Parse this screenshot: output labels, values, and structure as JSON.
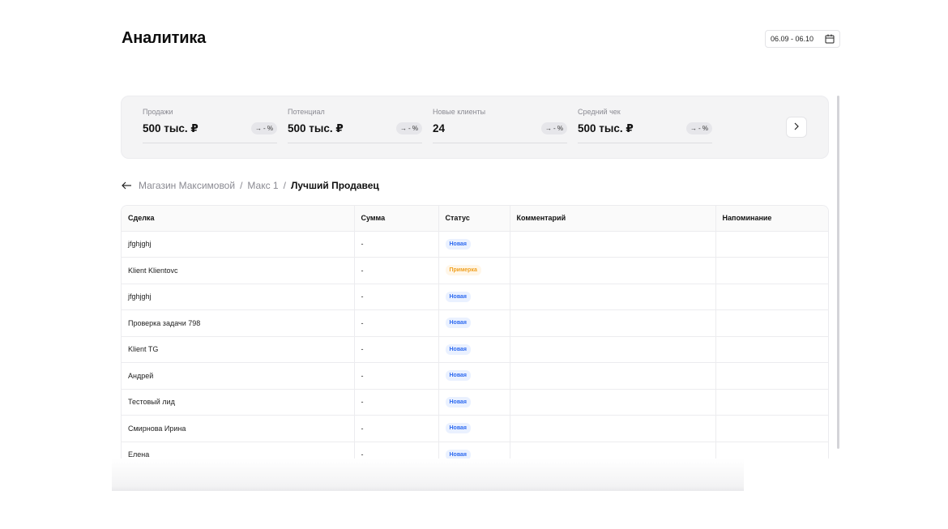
{
  "header": {
    "title": "Аналитика",
    "date_range": "06.09 - 06.10"
  },
  "kpis": [
    {
      "label": "Продажи",
      "value": "500 тыс. ₽",
      "trend": "- %"
    },
    {
      "label": "Потенциал",
      "value": "500 тыс. ₽",
      "trend": "- %"
    },
    {
      "label": "Новые клиенты",
      "value": "24",
      "trend": "- %"
    },
    {
      "label": "Средний чек",
      "value": "500 тыс. ₽",
      "trend": "- %"
    }
  ],
  "breadcrumb": {
    "items": [
      "Магазин Максимовой",
      "Макс 1"
    ],
    "separator": "/",
    "current": "Лучший Продавец"
  },
  "table": {
    "columns": [
      "Сделка",
      "Сумма",
      "Статус",
      "Комментарий",
      "Напоминание"
    ],
    "rows": [
      {
        "deal": "jfghjghj",
        "sum": "-",
        "status": "Новая",
        "status_type": "new",
        "comment": "",
        "reminder": ""
      },
      {
        "deal": "Klient Klientovc",
        "sum": "-",
        "status": "Примерка",
        "status_type": "fitting",
        "comment": "",
        "reminder": ""
      },
      {
        "deal": "jfghjghj",
        "sum": "-",
        "status": "Новая",
        "status_type": "new",
        "comment": "",
        "reminder": ""
      },
      {
        "deal": "Проверка задачи 798",
        "sum": "-",
        "status": "Новая",
        "status_type": "new",
        "comment": "",
        "reminder": ""
      },
      {
        "deal": "Klient TG",
        "sum": "-",
        "status": "Новая",
        "status_type": "new",
        "comment": "",
        "reminder": ""
      },
      {
        "deal": "Андрей",
        "sum": "-",
        "status": "Новая",
        "status_type": "new",
        "comment": "",
        "reminder": ""
      },
      {
        "deal": "Тестовый лид",
        "sum": "-",
        "status": "Новая",
        "status_type": "new",
        "comment": "",
        "reminder": ""
      },
      {
        "deal": "Смирнова Ирина",
        "sum": "-",
        "status": "Новая",
        "status_type": "new",
        "comment": "",
        "reminder": ""
      },
      {
        "deal": "Елена",
        "sum": "-",
        "status": "Новая",
        "status_type": "new",
        "comment": "",
        "reminder": ""
      }
    ]
  },
  "colors": {
    "status_new": "#2f6bf0",
    "status_fitting": "#f0a020",
    "panel_bg": "#f4f4f5"
  },
  "icons": {
    "calendar": "calendar-icon",
    "trend": "arrow-right-icon",
    "next": "chevron-right-icon",
    "back": "arrow-left-icon"
  }
}
